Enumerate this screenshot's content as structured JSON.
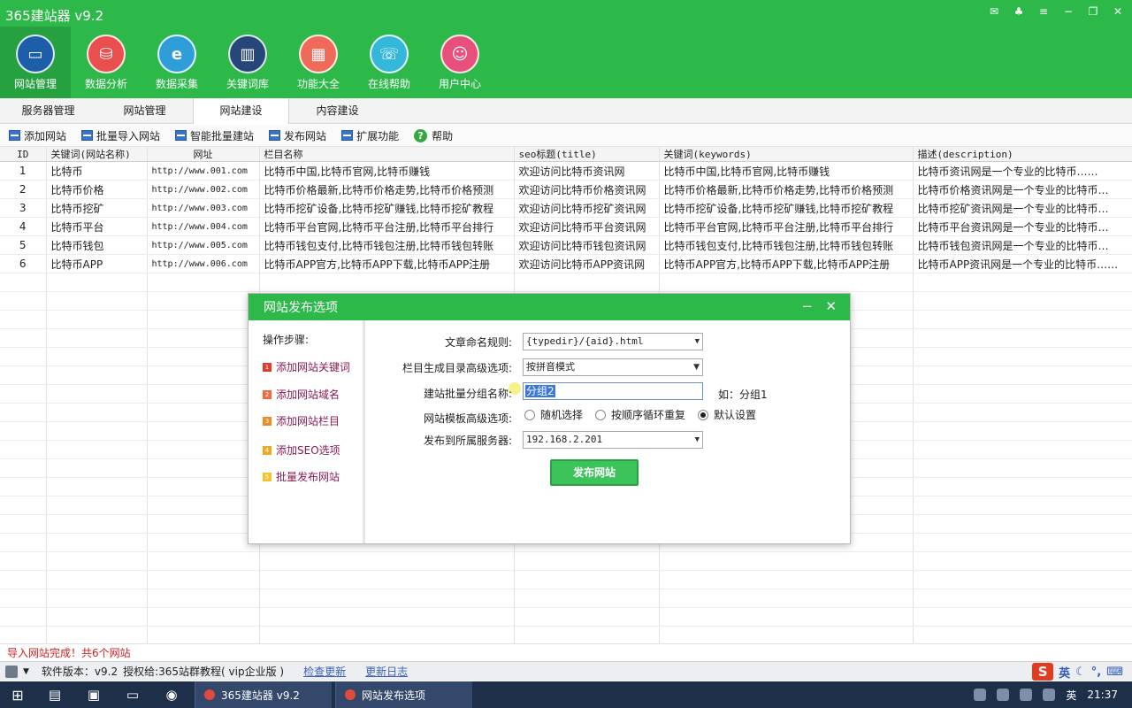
{
  "app": {
    "title": "365建站器 v9.2"
  },
  "nav": [
    {
      "label": "网站管理",
      "icon": "monitor-icon",
      "color": "#1c5fa8"
    },
    {
      "label": "数据分析",
      "icon": "database-icon",
      "color": "#e94f4f"
    },
    {
      "label": "数据采集",
      "icon": "edge-browser-icon",
      "color": "#2d9ed8"
    },
    {
      "label": "关键词库",
      "icon": "book-icon",
      "color": "#27477a"
    },
    {
      "label": "功能大全",
      "icon": "grid-icon",
      "color": "#f06a5a"
    },
    {
      "label": "在线帮助",
      "icon": "chat-icon",
      "color": "#35b7d9"
    },
    {
      "label": "用户中心",
      "icon": "user-icon",
      "color": "#e74f7c"
    }
  ],
  "subtabs": [
    "服务器管理",
    "网站管理",
    "网站建设",
    "内容建设"
  ],
  "toolbar": {
    "add_site": "添加网站",
    "batch_import": "批量导入网站",
    "smart_batch": "智能批量建站",
    "publish": "发布网站",
    "extend": "扩展功能",
    "help": "帮助"
  },
  "table": {
    "headers": [
      "ID",
      "关键词(网站名称)",
      "网址",
      "栏目名称",
      "seo标题(title)",
      "关键词(keywords)",
      "描述(description)"
    ],
    "rows": [
      [
        "1",
        "比特币",
        "http://www.001.com",
        "比特币中国,比特币官网,比特币赚钱",
        "欢迎访问比特币资讯网",
        "比特币中国,比特币官网,比特币赚钱",
        "比特币资讯网是一个专业的比特币……"
      ],
      [
        "2",
        "比特币价格",
        "http://www.002.com",
        "比特币价格最新,比特币价格走势,比特币价格预测",
        "欢迎访问比特币价格资讯网",
        "比特币价格最新,比特币价格走势,比特币价格预测",
        "比特币价格资讯网是一个专业的比特币…"
      ],
      [
        "3",
        "比特币挖矿",
        "http://www.003.com",
        "比特币挖矿设备,比特币挖矿赚钱,比特币挖矿教程",
        "欢迎访问比特币挖矿资讯网",
        "比特币挖矿设备,比特币挖矿赚钱,比特币挖矿教程",
        "比特币挖矿资讯网是一个专业的比特币…"
      ],
      [
        "4",
        "比特币平台",
        "http://www.004.com",
        "比特币平台官网,比特币平台注册,比特币平台排行",
        "欢迎访问比特币平台资讯网",
        "比特币平台官网,比特币平台注册,比特币平台排行",
        "比特币平台资讯网是一个专业的比特币…"
      ],
      [
        "5",
        "比特币钱包",
        "http://www.005.com",
        "比特币钱包支付,比特币钱包注册,比特币钱包转账",
        "欢迎访问比特币钱包资讯网",
        "比特币钱包支付,比特币钱包注册,比特币钱包转账",
        "比特币钱包资讯网是一个专业的比特币…"
      ],
      [
        "6",
        "比特币APP",
        "http://www.006.com",
        "比特币APP官方,比特币APP下载,比特币APP注册",
        "欢迎访问比特币APP资讯网",
        "比特币APP官方,比特币APP下载,比特币APP注册",
        "比特币APP资讯网是一个专业的比特币……"
      ]
    ]
  },
  "status": {
    "message": "导入网站完成！共6个网站",
    "version": "软件版本：v9.2",
    "license": "授权给:365站群教程( vip企业版 )",
    "check_update": "检查更新",
    "update_log": "更新日志",
    "ime_label": "英"
  },
  "dialog": {
    "title": "网站发布选项",
    "steps_title": "操作步骤:",
    "steps": [
      {
        "num": "1",
        "label": "添加网站关键词",
        "color": "#e23b2c"
      },
      {
        "num": "2",
        "label": "添加网站域名",
        "color": "#f06a3a"
      },
      {
        "num": "3",
        "label": "添加网站栏目",
        "color": "#f08a25"
      },
      {
        "num": "4",
        "label": "添加SEO选项",
        "color": "#f0a820"
      },
      {
        "num": "5",
        "label": "批量发布网站",
        "color": "#f4c430"
      }
    ],
    "naming_label": "文章命名规则:",
    "naming_value": "{typedir}/{aid}.html",
    "dir_label": "栏目生成目录高级选项:",
    "dir_value": "按拼音模式",
    "group_label": "建站批量分组名称:",
    "group_value": "分组2",
    "group_hint": "如：分组1",
    "template_label": "网站模板高级选项:",
    "template_options": [
      "随机选择",
      "按顺序循环重复",
      "默认设置"
    ],
    "template_selected": 2,
    "server_label": "发布到所属服务器:",
    "server_value": "192.168.2.201",
    "publish_button": "发布网站"
  },
  "taskbar": {
    "task1": "365建站器 v9.2",
    "task2": "网站发布选项",
    "ime": "英",
    "time": "21:37"
  }
}
